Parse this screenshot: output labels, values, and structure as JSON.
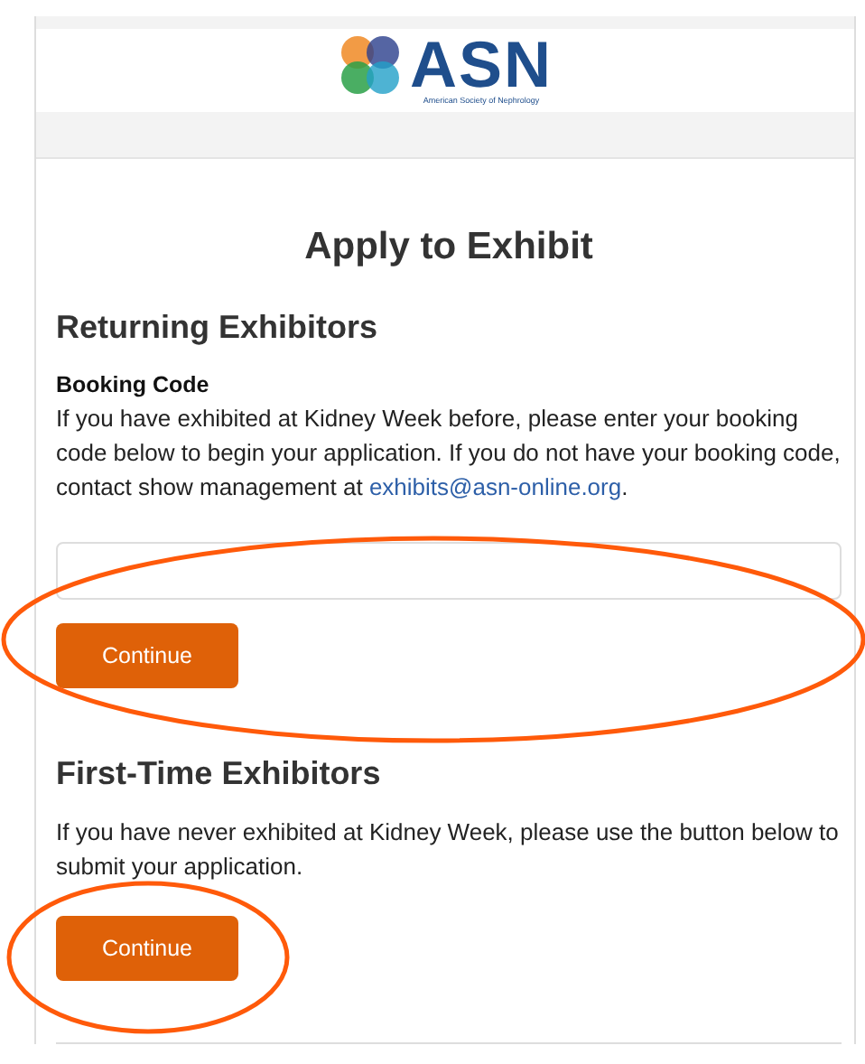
{
  "logo": {
    "wordmark": "ASN",
    "tagline": "American Society of Nephrology"
  },
  "title": "Apply to Exhibit",
  "sections": [
    {
      "kind": "booking",
      "heading": "Returning Exhibitors",
      "label": "Booking Code",
      "text": "If you have exhibited at Kidney Week before, please enter your booking code below to begin your application. If you do not have your booking code, contact show management at ",
      "link": "exhibits@asn-online.org",
      "after_link": ".",
      "button": "Continue",
      "highlighted": true
    },
    {
      "kind": "plain",
      "heading": "First-Time Exhibitors",
      "text": "If you have never exhibited at Kidney Week, please use the button below to submit your application.",
      "button": "Continue",
      "highlighted": true
    }
  ]
}
